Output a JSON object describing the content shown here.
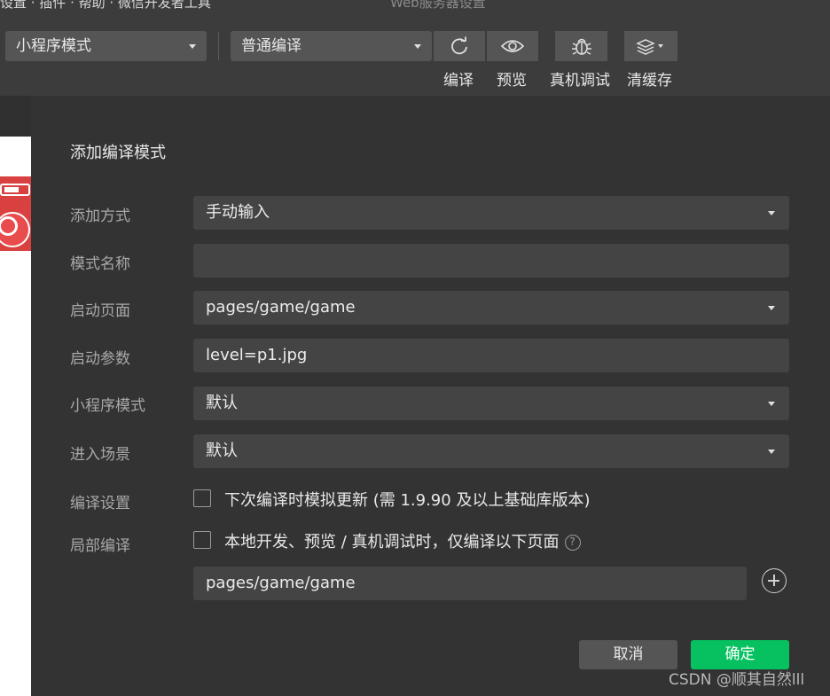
{
  "titlebar": {
    "text_left": "设置 · 插件 · 帮助 · 微信开发者工具",
    "text_right": "Web服务器设置"
  },
  "toolbar": {
    "mode_select": "小程序模式",
    "compile_select": "普通编译",
    "compile_label": "编译",
    "preview_label": "预览",
    "device_debug_label": "真机调试",
    "clear_cache_label": "清缓存"
  },
  "dialog": {
    "title": "添加编译模式",
    "fields": {
      "add_method": {
        "label": "添加方式",
        "value": "手动输入"
      },
      "mode_name": {
        "label": "模式名称",
        "value": ""
      },
      "start_page": {
        "label": "启动页面",
        "value": "pages/game/game"
      },
      "start_params": {
        "label": "启动参数",
        "value": "level=p1.jpg"
      },
      "miniprogram_mode": {
        "label": "小程序模式",
        "value": "默认"
      },
      "scene": {
        "label": "进入场景",
        "value": "默认"
      }
    },
    "compile_settings": {
      "label": "编译设置",
      "checkbox_text": "下次编译时模拟更新 (需 1.9.90 及以上基础库版本)",
      "checked": false
    },
    "partial_compile": {
      "label": "局部编译",
      "checkbox_text": "本地开发、预览 / 真机调试时，仅编译以下页面",
      "checked": false,
      "page": "pages/game/game"
    },
    "cancel_label": "取消",
    "confirm_label": "确定",
    "accent_color": "#07c160"
  },
  "watermark": "CSDN @顺其自然lll"
}
